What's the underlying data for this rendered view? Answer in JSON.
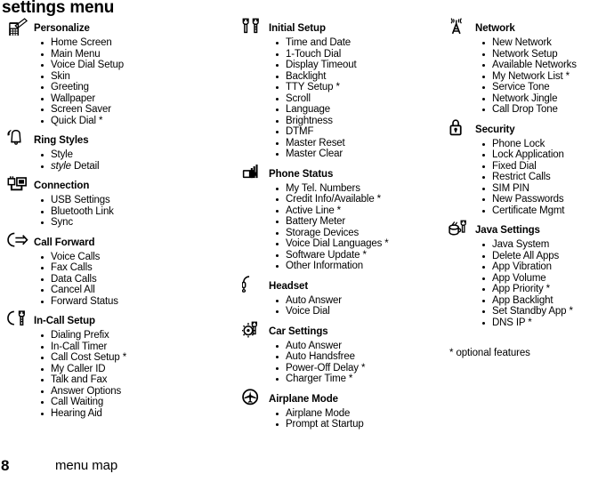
{
  "page": {
    "title": "settings menu",
    "footnote": "* optional features",
    "footer_page_number": "8",
    "footer_label": "menu map"
  },
  "columns": [
    {
      "groups": [
        {
          "icon": "phone-pencil-icon",
          "title": "Personalize",
          "items": [
            "Home Screen",
            "Main Menu",
            "Voice Dial Setup",
            "Skin",
            "Greeting",
            "Wallpaper",
            "Screen Saver",
            "Quick Dial *"
          ]
        },
        {
          "icon": "ringing-bell-icon",
          "title": "Ring Styles",
          "items": [
            "Style",
            "style Detail"
          ],
          "italic_items": [
            1
          ]
        },
        {
          "icon": "connection-plug-icon",
          "title": "Connection",
          "items": [
            "USB Settings",
            "Bluetooth Link",
            "Sync"
          ]
        },
        {
          "icon": "call-forward-arrow-icon",
          "title": "Call Forward",
          "items": [
            "Voice Calls",
            "Fax Calls",
            "Data Calls",
            "Cancel All",
            "Forward Status"
          ]
        },
        {
          "icon": "in-call-wrench-icon",
          "title": "In-Call Setup",
          "items": [
            "Dialing Prefix",
            "In-Call Timer",
            "Call Cost Setup *",
            "My Caller ID",
            "Talk and Fax",
            "Answer Options",
            "Call Waiting",
            "Hearing Aid"
          ]
        }
      ]
    },
    {
      "groups": [
        {
          "icon": "initial-setup-wrench-icon",
          "title": "Initial Setup",
          "items": [
            "Time and Date",
            "1-Touch Dial",
            "Display Timeout",
            "Backlight",
            "TTY Setup *",
            "Scroll",
            "Language",
            "Brightness",
            "DTMF",
            "Master Reset",
            "Master Clear"
          ]
        },
        {
          "icon": "phone-status-battery-icon",
          "title": "Phone Status",
          "items": [
            "My Tel. Numbers",
            "Credit Info/Available *",
            "Active Line *",
            "Battery Meter",
            "Storage Devices",
            "Voice Dial Languages *",
            "Software Update *",
            "Other Information"
          ]
        },
        {
          "icon": "headset-icon",
          "title": "Headset",
          "items": [
            "Auto Answer",
            "Voice Dial"
          ]
        },
        {
          "icon": "car-settings-icon",
          "title": "Car Settings",
          "items": [
            "Auto Answer",
            "Auto Handsfree",
            "Power-Off Delay *",
            "Charger Time *"
          ]
        },
        {
          "icon": "airplane-mode-icon",
          "title": "Airplane Mode",
          "items": [
            "Airplane Mode",
            "Prompt at Startup"
          ]
        }
      ]
    },
    {
      "groups": [
        {
          "icon": "network-tower-icon",
          "title": "Network",
          "items": [
            "New Network",
            "Network Setup",
            "Available Networks",
            "My Network List *",
            "Service Tone",
            "Network Jingle",
            "Call Drop Tone"
          ]
        },
        {
          "icon": "security-padlock-icon",
          "title": "Security",
          "items": [
            "Phone Lock",
            "Lock Application",
            "Fixed Dial",
            "Restrict Calls",
            "SIM PIN",
            "New Passwords",
            "Certificate Mgmt"
          ]
        },
        {
          "icon": "java-settings-icon",
          "title": "Java Settings",
          "items": [
            "Java System",
            "Delete All Apps",
            "App Vibration",
            "App Volume",
            "App Priority *",
            "App Backlight",
            "Set Standby App *",
            "DNS IP *"
          ]
        }
      ]
    }
  ]
}
